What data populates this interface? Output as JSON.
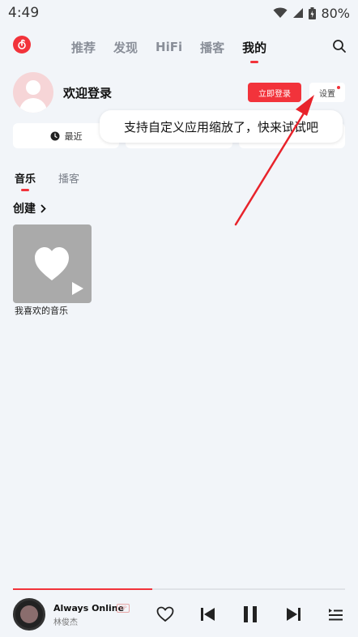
{
  "status_bar": {
    "time": "4:49",
    "battery": "80%"
  },
  "nav": {
    "tabs": [
      {
        "label": "推荐",
        "active": false
      },
      {
        "label": "发现",
        "active": false
      },
      {
        "label": "HiFi",
        "active": false
      },
      {
        "label": "播客",
        "active": false
      },
      {
        "label": "我的",
        "active": true
      }
    ]
  },
  "profile": {
    "welcome": "欢迎登录",
    "login_button": "立即登录",
    "settings_button": "设置"
  },
  "quick_row": {
    "recent_label": "最近"
  },
  "tooltip": {
    "text": "支持自定义应用缩放了，快来试试吧"
  },
  "sub_tabs": [
    {
      "label": "音乐",
      "active": true
    },
    {
      "label": "播客",
      "active": false
    }
  ],
  "create_section": {
    "header": "创建"
  },
  "playlists": [
    {
      "title": "我喜欢的音乐"
    }
  ],
  "player": {
    "song_title": "Always Online",
    "badge": "VIP",
    "artist": "林俊杰",
    "progress": 0.42
  },
  "colors": {
    "accent": "#f2333b",
    "background": "#f2f5f9"
  }
}
